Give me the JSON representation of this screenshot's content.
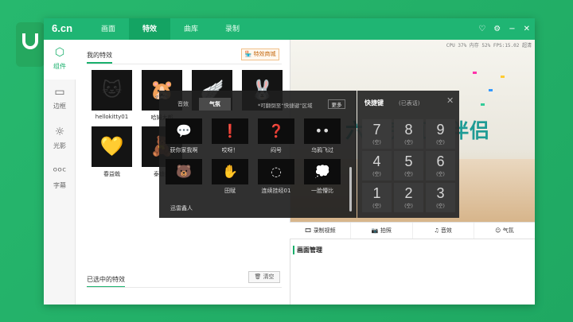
{
  "app": {
    "brand": "6.cn"
  },
  "nav": [
    {
      "label": "画面"
    },
    {
      "label": "特效",
      "active": true
    },
    {
      "label": "曲库"
    },
    {
      "label": "录制"
    }
  ],
  "window_controls": {
    "skin": "♡",
    "settings": "⚙",
    "minimize": "−",
    "close": "✕"
  },
  "sidebar": [
    {
      "label": "组件",
      "icon": "component-icon",
      "active": true
    },
    {
      "label": "边框",
      "icon": "frame-icon"
    },
    {
      "label": "光影",
      "icon": "light-icon"
    },
    {
      "label": "字幕",
      "icon": "subtitle-icon"
    }
  ],
  "effects": {
    "my_title": "我的特效",
    "shop_label": "特效商城",
    "items": [
      {
        "label": "hellokitty01",
        "glyph": "🐱"
      },
      {
        "label": "哈姆太郎",
        "glyph": "🐹"
      },
      {
        "label": "",
        "glyph": "🪽"
      },
      {
        "label": "",
        "glyph": "🐰"
      },
      {
        "label": "春益戟",
        "glyph": "💛"
      },
      {
        "label": "泰迪熊",
        "glyph": "🧸"
      }
    ],
    "selected_title": "已选中的特效",
    "clear_label": "清空"
  },
  "overlay": {
    "tabs": [
      {
        "label": "音效"
      },
      {
        "label": "气氛",
        "active": true
      }
    ],
    "hint": "*可翻倒至“快捷键”区域",
    "more": "更多",
    "items": [
      {
        "label": "获你家我啊",
        "glyph": "💬"
      },
      {
        "label": "哎呀！",
        "glyph": "❗"
      },
      {
        "label": "闷号",
        "glyph": "❓"
      },
      {
        "label": "乌鸦飞过",
        "glyph": "••"
      },
      {
        "label": "一脸懵比",
        "glyph": "💭"
      },
      {
        "label": "",
        "glyph": "🐻"
      },
      {
        "label": "田赋",
        "glyph": "✋"
      },
      {
        "label": "连续挂经01",
        "glyph": "◌"
      }
    ],
    "last_label": "迅雷鑫人"
  },
  "hotkeys": {
    "title": "快捷键",
    "used": "(已表话)",
    "close": "✕",
    "keys": [
      {
        "num": "7",
        "sub": "(空)"
      },
      {
        "num": "8",
        "sub": "(空)"
      },
      {
        "num": "9",
        "sub": "(空)"
      },
      {
        "num": "4",
        "sub": "(空)"
      },
      {
        "num": "5",
        "sub": "(空)"
      },
      {
        "num": "6",
        "sub": "(空)"
      },
      {
        "num": "1",
        "sub": "(空)"
      },
      {
        "num": "2",
        "sub": "(空)"
      },
      {
        "num": "3",
        "sub": "(空)"
      }
    ]
  },
  "preview": {
    "stats": "CPU 37% 内存 52% FPS:15.02 超清",
    "banner": "六间房直播伴侣"
  },
  "toolbar": [
    {
      "label": "录制视频",
      "icon": "video-icon"
    },
    {
      "label": "拍照",
      "icon": "camera-icon"
    },
    {
      "label": "音效",
      "icon": "sound-icon"
    },
    {
      "label": "气氛",
      "icon": "mood-icon"
    }
  ],
  "scene": {
    "title": "画面管理"
  },
  "colors": {
    "accent": "#1fb573",
    "panel_dark": "#1e1e1e"
  }
}
